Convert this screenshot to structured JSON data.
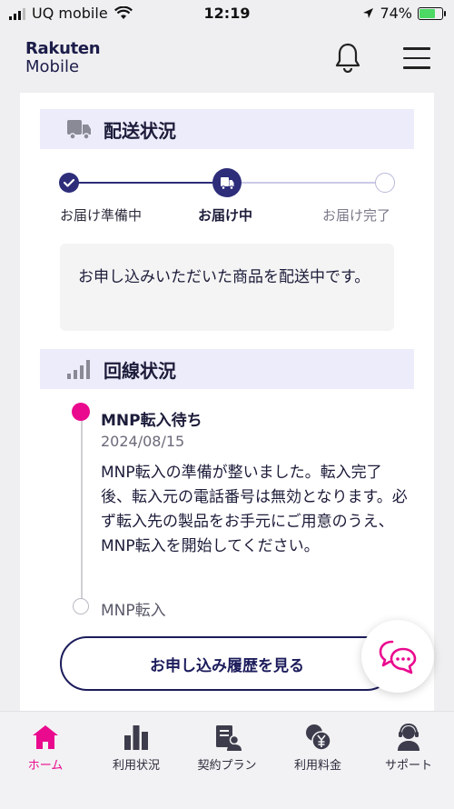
{
  "status_bar": {
    "carrier": "UQ mobile",
    "time": "12:19",
    "battery": "74%",
    "battery_level": 0.74
  },
  "header": {
    "logo_line1": "Rakuten",
    "logo_line2": "Mobile"
  },
  "delivery": {
    "title": "配送状況",
    "steps": [
      {
        "label": "お届け準備中",
        "state": "done"
      },
      {
        "label": "お届け中",
        "state": "current"
      },
      {
        "label": "お届け完了",
        "state": "pending"
      }
    ],
    "message": "お申し込みいただいた商品を配送中です。"
  },
  "line_status": {
    "title": "回線状況",
    "current": {
      "title": "MNP転入待ち",
      "date": "2024/08/15",
      "body": "MNP転入の準備が整いました。転入完了後、転入元の電話番号は無効となります。必ず転入先の製品をお手元にご用意のうえ、MNP転入を開始してください。"
    },
    "next": {
      "title": "MNP転入"
    }
  },
  "history_button": "お申し込み履歴を見る",
  "bottom_nav": {
    "items": [
      {
        "label": "ホーム",
        "icon": "home-icon",
        "active": true
      },
      {
        "label": "利用状況",
        "icon": "bar-chart-icon",
        "active": false
      },
      {
        "label": "契約プラン",
        "icon": "contract-icon",
        "active": false
      },
      {
        "label": "利用料金",
        "icon": "yen-coins-icon",
        "active": false
      },
      {
        "label": "サポート",
        "icon": "support-agent-icon",
        "active": false
      }
    ]
  },
  "colors": {
    "brand_navy": "#2d2d7a",
    "accent_pink": "#ea0a8e",
    "section_bg": "#ececfa"
  }
}
